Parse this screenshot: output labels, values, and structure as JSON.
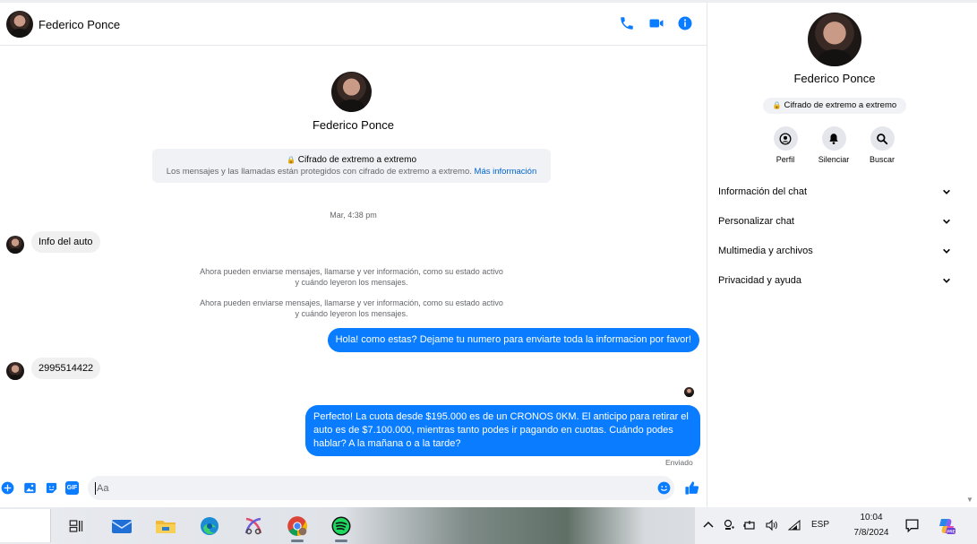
{
  "header": {
    "contact_name": "Federico Ponce",
    "icons": [
      "phone-icon",
      "video-camera-icon",
      "info-icon"
    ]
  },
  "thread": {
    "contact_name": "Federico Ponce",
    "encryption_title": "Cifrado de extremo a extremo",
    "encryption_desc": "Los mensajes y las llamadas están protegidos con cifrado de extremo a extremo.",
    "encryption_link": "Más información",
    "timestamp": "Mar, 4:38 pm",
    "messages": [
      {
        "from": "contact",
        "text": "Info del auto"
      },
      {
        "from": "system",
        "text": "Ahora pueden enviarse mensajes, llamarse y ver información, como su estado activo y cuándo leyeron los mensajes."
      },
      {
        "from": "system",
        "text": "Ahora pueden enviarse mensajes, llamarse y ver información, como su estado activo y cuándo leyeron los mensajes."
      },
      {
        "from": "me",
        "text": "Hola! como estas? Dejame tu numero para enviarte toda la informacion por favor!"
      },
      {
        "from": "contact",
        "text": "2995514422"
      },
      {
        "from": "me",
        "text": "Perfecto! La cuota desde $195.000 es de un CRONOS 0KM. El anticipo para retirar el auto es de $7.100.000, mientras tanto podes ir pagando en cuotas. Cuándo podes hablar? A la mañana o a la tarde?"
      }
    ],
    "sent_status": "Enviado"
  },
  "composer": {
    "placeholder": "Aa",
    "icons": [
      "plus-circle-icon",
      "photo-icon",
      "sticker-icon",
      "gif-icon",
      "emoji-icon",
      "thumbs-up-icon"
    ],
    "gif_label": "GIF"
  },
  "info_panel": {
    "name": "Federico Ponce",
    "encryption_badge": "Cifrado de extremo a extremo",
    "actions": [
      {
        "label": "Perfil",
        "icon": "profile-icon"
      },
      {
        "label": "Silenciar",
        "icon": "bell-icon"
      },
      {
        "label": "Buscar",
        "icon": "search-icon"
      }
    ],
    "sections": [
      {
        "label": "Información del chat"
      },
      {
        "label": "Personalizar chat"
      },
      {
        "label": "Multimedia y archivos"
      },
      {
        "label": "Privacidad y ayuda"
      }
    ]
  },
  "taskbar": {
    "apps": [
      "task-view-icon",
      "mail-icon",
      "file-explorer-icon",
      "edge-icon",
      "snipping-tool-icon",
      "chrome-icon",
      "spotify-icon"
    ],
    "language": "ESP",
    "time": "10:04",
    "date": "7/8/2024"
  },
  "colors": {
    "accent": "#0a7cff",
    "incoming_bubble": "#f0f0f0",
    "link": "#0064d1",
    "muted_text": "#65676b"
  }
}
